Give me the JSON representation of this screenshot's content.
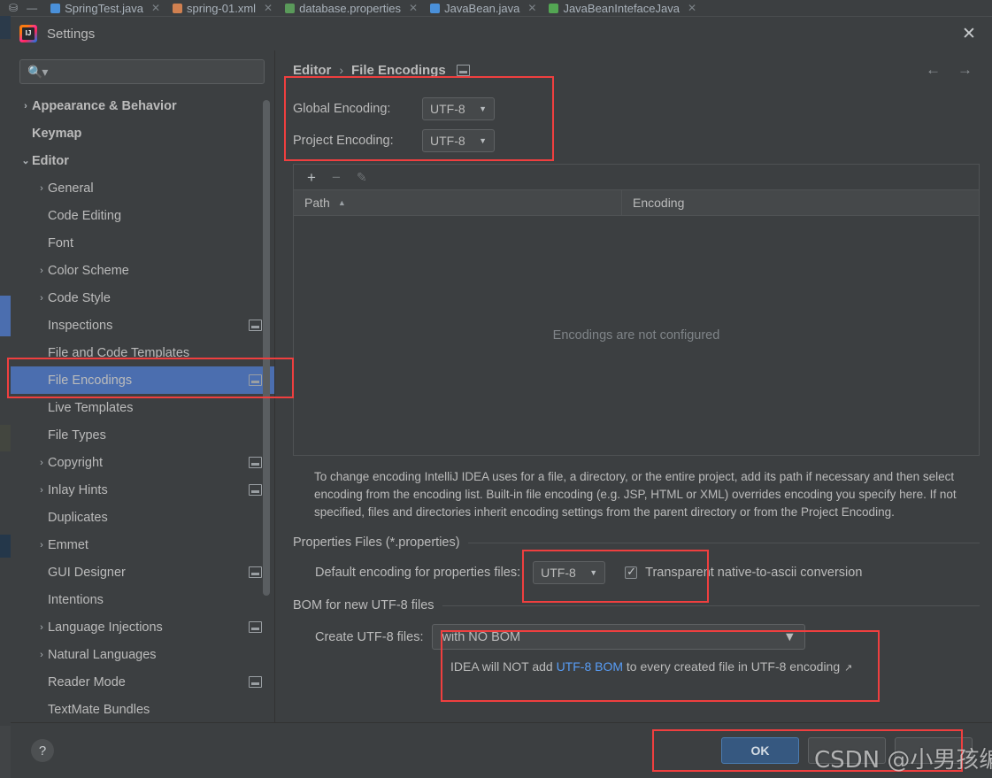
{
  "ide": {
    "tabs": [
      {
        "label": "SpringTest.java",
        "icon_color": "#4a90d9"
      },
      {
        "label": "spring-01.xml",
        "icon_color": "#d08050"
      },
      {
        "label": "database.properties",
        "icon_color": "#5a9a5a"
      },
      {
        "label": "JavaBean.java",
        "icon_color": "#4a90d9"
      },
      {
        "label": "JavaBeanIntefaceJava",
        "icon_color": "#53a653"
      }
    ],
    "close_icon": "close-icon"
  },
  "dialog": {
    "title": "Settings",
    "close_icon": "close-icon"
  },
  "search": {
    "placeholder": "",
    "value": "",
    "icon": "search-icon"
  },
  "sidebar": {
    "items": [
      {
        "label": "Appearance & Behavior",
        "level": 0,
        "arrow": "collapsed",
        "badge": false,
        "selected": false
      },
      {
        "label": "Keymap",
        "level": 0,
        "arrow": "none",
        "badge": false,
        "selected": false
      },
      {
        "label": "Editor",
        "level": 0,
        "arrow": "expanded",
        "badge": false,
        "selected": false
      },
      {
        "label": "General",
        "level": 1,
        "arrow": "collapsed",
        "badge": false,
        "selected": false
      },
      {
        "label": "Code Editing",
        "level": 1,
        "arrow": "none",
        "badge": false,
        "selected": false
      },
      {
        "label": "Font",
        "level": 1,
        "arrow": "none",
        "badge": false,
        "selected": false
      },
      {
        "label": "Color Scheme",
        "level": 1,
        "arrow": "collapsed",
        "badge": false,
        "selected": false
      },
      {
        "label": "Code Style",
        "level": 1,
        "arrow": "collapsed",
        "badge": false,
        "selected": false
      },
      {
        "label": "Inspections",
        "level": 1,
        "arrow": "none",
        "badge": true,
        "selected": false
      },
      {
        "label": "File and Code Templates",
        "level": 1,
        "arrow": "none",
        "badge": false,
        "selected": false
      },
      {
        "label": "File Encodings",
        "level": 1,
        "arrow": "none",
        "badge": true,
        "selected": true
      },
      {
        "label": "Live Templates",
        "level": 1,
        "arrow": "none",
        "badge": false,
        "selected": false
      },
      {
        "label": "File Types",
        "level": 1,
        "arrow": "none",
        "badge": false,
        "selected": false
      },
      {
        "label": "Copyright",
        "level": 1,
        "arrow": "collapsed",
        "badge": true,
        "selected": false
      },
      {
        "label": "Inlay Hints",
        "level": 1,
        "arrow": "collapsed",
        "badge": true,
        "selected": false
      },
      {
        "label": "Duplicates",
        "level": 1,
        "arrow": "none",
        "badge": false,
        "selected": false
      },
      {
        "label": "Emmet",
        "level": 1,
        "arrow": "collapsed",
        "badge": false,
        "selected": false
      },
      {
        "label": "GUI Designer",
        "level": 1,
        "arrow": "none",
        "badge": true,
        "selected": false
      },
      {
        "label": "Intentions",
        "level": 1,
        "arrow": "none",
        "badge": false,
        "selected": false
      },
      {
        "label": "Language Injections",
        "level": 1,
        "arrow": "collapsed",
        "badge": true,
        "selected": false
      },
      {
        "label": "Natural Languages",
        "level": 1,
        "arrow": "collapsed",
        "badge": false,
        "selected": false
      },
      {
        "label": "Reader Mode",
        "level": 1,
        "arrow": "none",
        "badge": true,
        "selected": false
      },
      {
        "label": "TextMate Bundles",
        "level": 1,
        "arrow": "none",
        "badge": false,
        "selected": false
      }
    ]
  },
  "main": {
    "breadcrumb": {
      "parent": "Editor",
      "separator": "›",
      "current": "File Encodings"
    },
    "nav": {
      "back": "←",
      "forward": "→"
    },
    "global_encoding": {
      "label": "Global Encoding:",
      "value": "UTF-8"
    },
    "project_encoding": {
      "label": "Project Encoding:",
      "value": "UTF-8"
    },
    "table": {
      "toolbar": {
        "add": "+",
        "remove": "−",
        "edit": "✎"
      },
      "columns": [
        "Path",
        "Encoding"
      ],
      "sort_indicator": "▲",
      "rows": [],
      "empty_text": "Encodings are not configured"
    },
    "description": "To change encoding IntelliJ IDEA uses for a file, a directory, or the entire project, add its path if necessary and then select encoding from the encoding list. Built-in file encoding (e.g. JSP, HTML or XML) overrides encoding you specify here. If not specified, files and directories inherit encoding settings from the parent directory or from the Project Encoding.",
    "properties_group": {
      "title": "Properties Files (*.properties)",
      "default_encoding_label": "Default encoding for properties files:",
      "default_encoding_value": "UTF-8",
      "transparent_label": "Transparent native-to-ascii conversion",
      "transparent_checked": true
    },
    "bom_group": {
      "title": "BOM for new UTF-8 files",
      "create_label": "Create UTF-8 files:",
      "create_value": "with NO BOM",
      "hint_prefix": "IDEA will NOT add ",
      "hint_link": "UTF-8 BOM",
      "hint_suffix": " to every created file in UTF-8 encoding",
      "external_icon": "↗"
    }
  },
  "footer": {
    "help_label": "?",
    "ok_label": "OK",
    "cancel_label": "",
    "apply_label": ""
  },
  "watermark": {
    "text": "CSDN @小男孩编程"
  },
  "colors": {
    "accent_selection": "#4b6eaf",
    "primary_button": "#365880",
    "annotation": "#ef3f3f",
    "link": "#589df6",
    "panel_bg": "#3c3f41"
  }
}
